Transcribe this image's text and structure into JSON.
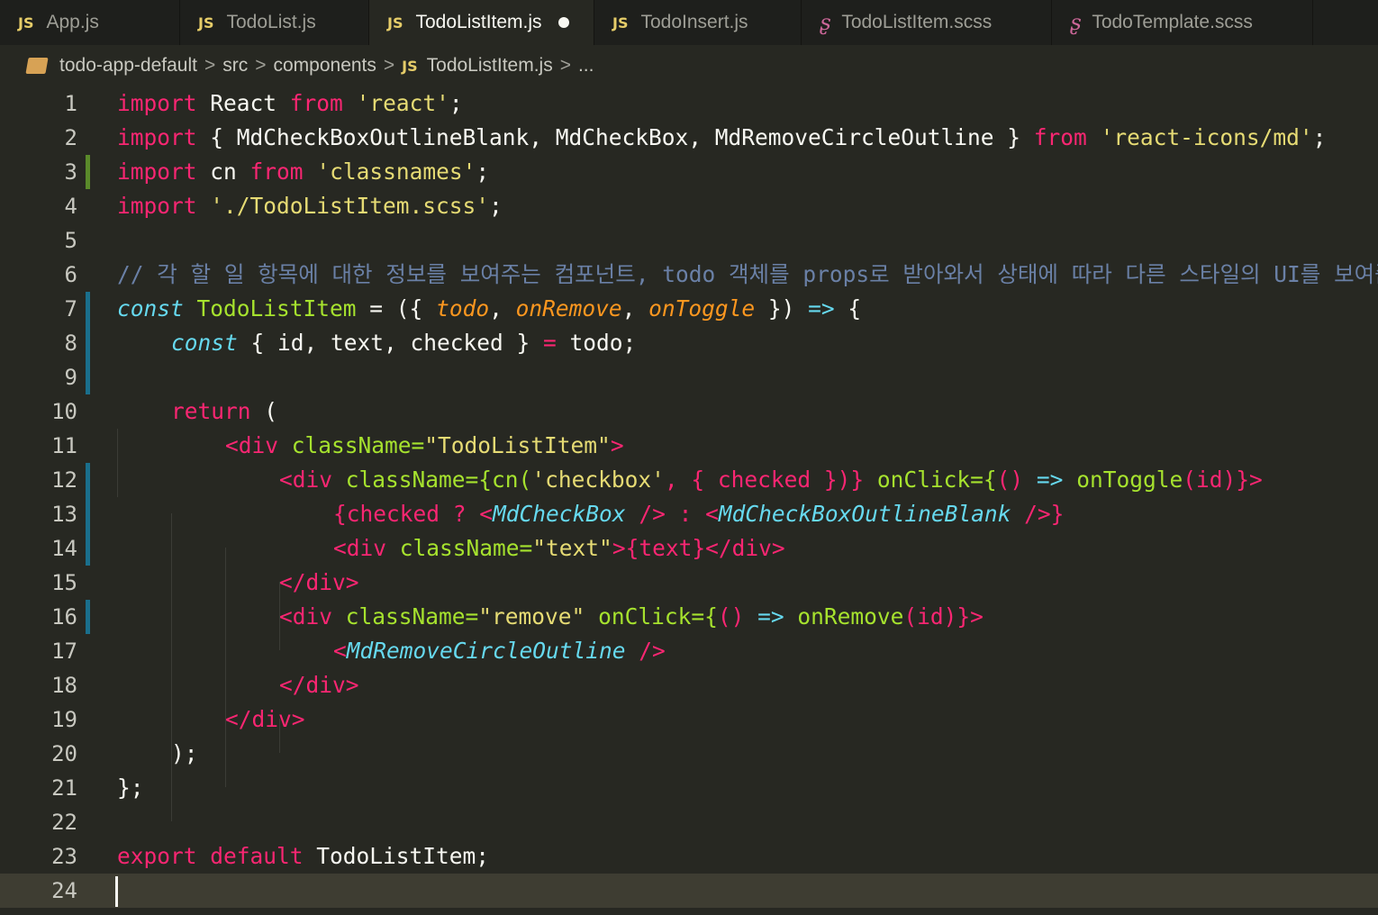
{
  "tabs": [
    {
      "label": "App.js",
      "type": "JS",
      "active": false,
      "modified": false
    },
    {
      "label": "TodoList.js",
      "type": "JS",
      "active": false,
      "modified": false
    },
    {
      "label": "TodoListItem.js",
      "type": "JS",
      "active": true,
      "modified": true
    },
    {
      "label": "TodoInsert.js",
      "type": "JS",
      "active": false,
      "modified": false
    },
    {
      "label": "TodoListItem.scss",
      "type": "SCSS",
      "active": false,
      "modified": false
    },
    {
      "label": "TodoTemplate.scss",
      "type": "SCSS",
      "active": false,
      "modified": false
    }
  ],
  "breadcrumb": {
    "project": "todo-app-default",
    "segments": [
      "src",
      "components"
    ],
    "file_type": "JS",
    "file": "TodoListItem.js",
    "more": "..."
  },
  "line_numbers": [
    "1",
    "2",
    "3",
    "4",
    "5",
    "6",
    "7",
    "8",
    "9",
    "10",
    "11",
    "12",
    "13",
    "14",
    "15",
    "16",
    "17",
    "18",
    "19",
    "20",
    "21",
    "22",
    "23",
    "24"
  ],
  "code": {
    "l1": [
      "import",
      " React ",
      "from",
      " ",
      "'react'",
      ";"
    ],
    "l2": [
      "import",
      " { MdCheckBoxOutlineBlank, MdCheckBox, MdRemoveCircleOutline } ",
      "from",
      " ",
      "'react-icons/md'",
      ";"
    ],
    "l3": [
      "import",
      " cn ",
      "from",
      " ",
      "'classnames'",
      ";"
    ],
    "l4": [
      "import",
      " ",
      "'./TodoListItem.scss'",
      ";"
    ],
    "l6": "// 각 할 일 항목에 대한 정보를 보여주는 컴포넌트, todo 객체를 props로 받아와서 상태에 따라 다른 스타일의 UI를 보여줌",
    "l7": [
      "const",
      " ",
      "TodoListItem",
      " = ({ ",
      "todo",
      ", ",
      "onRemove",
      ", ",
      "onToggle",
      " }) ",
      "=>",
      " {"
    ],
    "l8": [
      "const",
      " { id, text, checked } ",
      "=",
      " todo;"
    ],
    "l10": [
      "return",
      " ("
    ],
    "l11": [
      "<div",
      " ",
      "className=",
      "\"TodoListItem\"",
      ">"
    ],
    "l12": [
      "<div",
      " ",
      "className={",
      "cn(",
      "'checkbox'",
      ", { ",
      "checked",
      " })}",
      " ",
      "onClick={",
      "() ",
      "=>",
      " ",
      "onToggle",
      "(id)",
      "}>"
    ],
    "l13": [
      "{",
      "checked ? ",
      "<",
      "MdCheckBox",
      " /> : ",
      "<",
      "MdCheckBoxOutlineBlank",
      " />}"
    ],
    "l14": [
      "<div",
      " ",
      "className=",
      "\"text\"",
      ">{text}</div>"
    ],
    "l15": "</div>",
    "l16": [
      "<div",
      " ",
      "className=",
      "\"remove\"",
      " ",
      "onClick={",
      "() ",
      "=>",
      " ",
      "onRemove",
      "(id)",
      "}>"
    ],
    "l17": [
      "<",
      "MdRemoveCircleOutline",
      " />"
    ],
    "l18": "</div>",
    "l19": "</div>",
    "l20": ");",
    "l21": "};",
    "l23": [
      "export",
      " ",
      "default",
      " TodoListItem;"
    ]
  },
  "colors": {
    "background": "#272822",
    "keyword": "#f92672",
    "string": "#e6db74",
    "function": "#a6e22e",
    "type": "#66d9ef",
    "param": "#fd971f"
  }
}
